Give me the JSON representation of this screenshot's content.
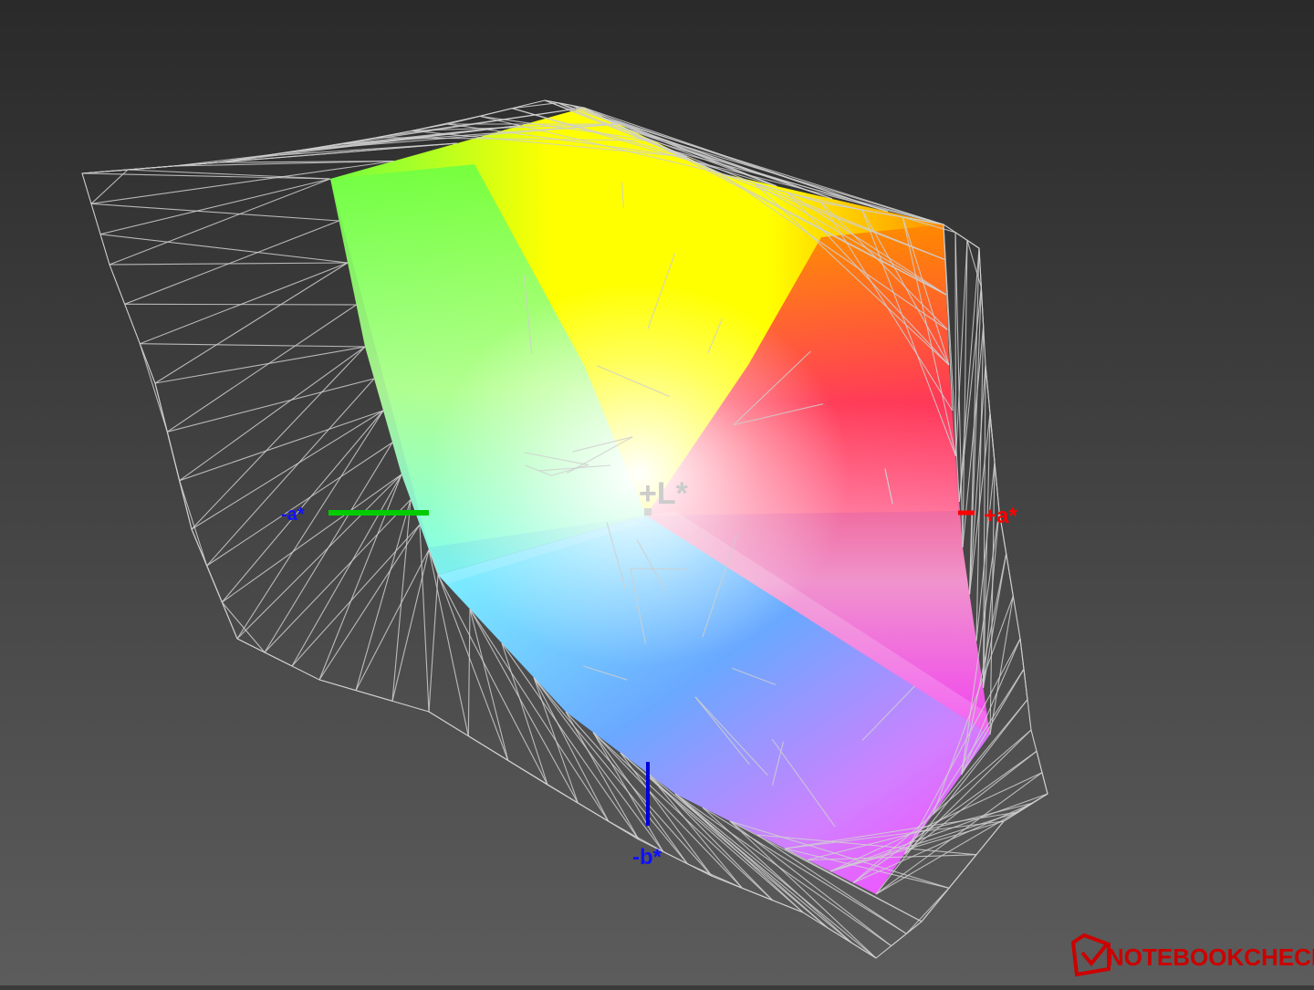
{
  "chart_data": {
    "type": "3d-gamut",
    "title": "",
    "axes": {
      "lightness_label": "+L*",
      "positive_a_label": "+a*",
      "negative_a_label": "-a*",
      "negative_b_label": "-b*"
    },
    "colors": {
      "background_top": "#2a2a2a",
      "background_bottom": "#5c5c5c",
      "wireframe": "#cfcfcf",
      "axis_negative_a": "#00cc00",
      "axis_positive_a": "#ff0000",
      "axis_negative_b": "#0000dd",
      "label_positive_a": "#ff0000",
      "label_negative_a": "#1010ff",
      "label_negative_b": "#1010ff",
      "label_lightness": "#cccccc",
      "gamut_yellow": "#ffff00",
      "gamut_green": "#70ff40",
      "gamut_cyan": "#80ffff",
      "gamut_blue": "#6aa8ff",
      "gamut_magenta": "#ff40ff",
      "gamut_red": "#ff3060",
      "gamut_orange": "#ff8800",
      "gamut_violet": "#a060ff",
      "gamut_white": "#ffffff"
    },
    "grid": true,
    "legend": "none"
  },
  "branding": {
    "logo_text": "NOTEBOOKCHECK",
    "logo_color": "#cc0000"
  }
}
